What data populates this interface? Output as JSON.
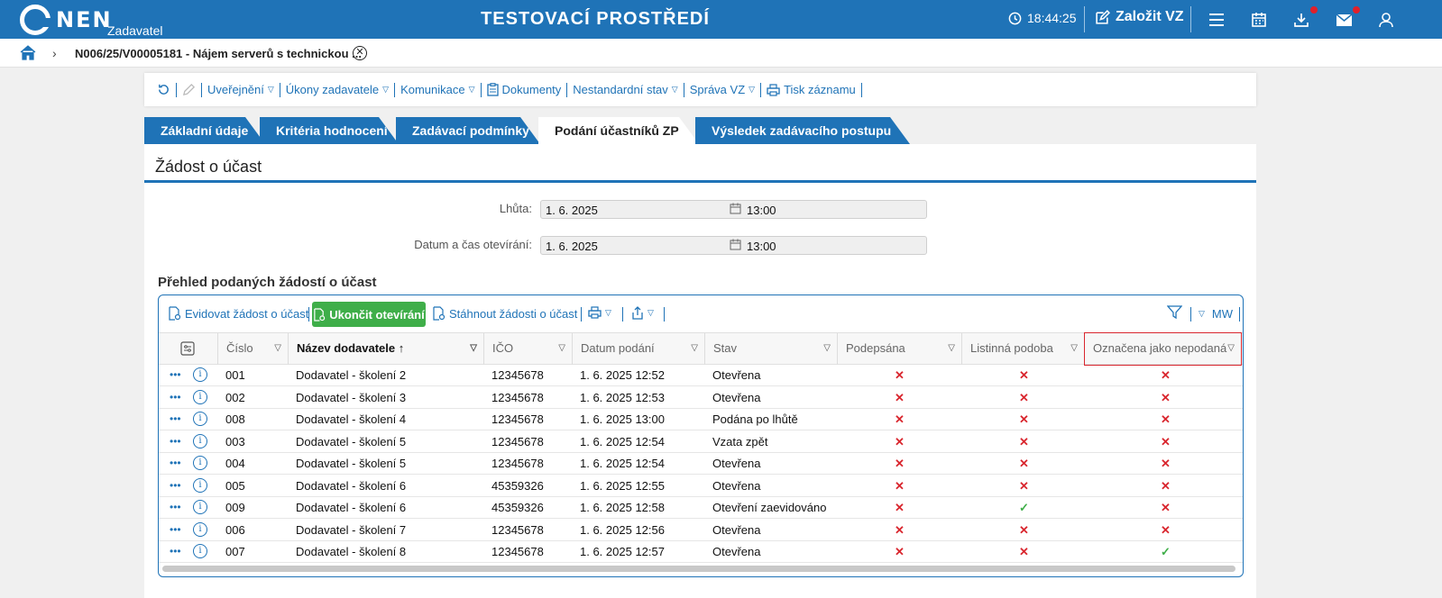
{
  "header": {
    "logo_text": "NEN",
    "logo_sub": "Zadavatel",
    "env_title": "TESTOVACÍ PROSTŘEDÍ",
    "time": "18:44:25",
    "create_label": "Založit VZ"
  },
  "breadcrumb": {
    "title": "N006/25/V00005181 - Nájem serverů s technickou ..."
  },
  "actions": {
    "items": [
      "Uveřejnění",
      "Úkony zadavatele",
      "Komunikace",
      "Dokumenty",
      "Nestandardní stav",
      "Správa VZ",
      "Tisk záznamu"
    ]
  },
  "tabs": [
    "Základní údaje",
    "Kritéria hodnocení",
    "Zadávací podmínky",
    "Podání účastníků ZP",
    "Výsledek zadávacího postupu"
  ],
  "panel": {
    "title": "Žádost o účast",
    "deadline_label": "Lhůta:",
    "deadline_date": "1. 6. 2025",
    "deadline_time": "13:00",
    "opening_label": "Datum a čas otevírání:",
    "opening_date": "1. 6. 2025",
    "opening_time": "13:00",
    "section_title": "Přehled podaných žádostí o účast"
  },
  "grid_toolbar": {
    "register": "Evidovat žádost o účast",
    "finish_opening": "Ukončit otevírání",
    "download": "Stáhnout žádosti o účast",
    "mw": "MW"
  },
  "columns": [
    "Číslo",
    "Název dodavatele",
    "IČO",
    "Datum podání",
    "Stav",
    "Podepsána",
    "Listinná podoba",
    "Označena jako nepodaná"
  ],
  "rows": [
    {
      "cislo": "001",
      "nazev": "Dodavatel - školení 2",
      "ico": "12345678",
      "datum": "1. 6. 2025 12:52",
      "stav": "Otevřena",
      "podepsana": "✕",
      "listinna": "✕",
      "nepodana": "✕"
    },
    {
      "cislo": "002",
      "nazev": "Dodavatel - školení 3",
      "ico": "12345678",
      "datum": "1. 6. 2025 12:53",
      "stav": "Otevřena",
      "podepsana": "✕",
      "listinna": "✕",
      "nepodana": "✕"
    },
    {
      "cislo": "008",
      "nazev": "Dodavatel - školení 4",
      "ico": "12345678",
      "datum": "1. 6. 2025 13:00",
      "stav": "Podána po lhůtě",
      "podepsana": "✕",
      "listinna": "✕",
      "nepodana": "✕"
    },
    {
      "cislo": "003",
      "nazev": "Dodavatel - školení 5",
      "ico": "12345678",
      "datum": "1. 6. 2025 12:54",
      "stav": "Vzata zpět",
      "podepsana": "✕",
      "listinna": "✕",
      "nepodana": "✕"
    },
    {
      "cislo": "004",
      "nazev": "Dodavatel - školení 5",
      "ico": "12345678",
      "datum": "1. 6. 2025 12:54",
      "stav": "Otevřena",
      "podepsana": "✕",
      "listinna": "✕",
      "nepodana": "✕"
    },
    {
      "cislo": "005",
      "nazev": "Dodavatel - školení 6",
      "ico": "45359326",
      "datum": "1. 6. 2025 12:55",
      "stav": "Otevřena",
      "podepsana": "✕",
      "listinna": "✕",
      "nepodana": "✕"
    },
    {
      "cislo": "009",
      "nazev": "Dodavatel - školení 6",
      "ico": "45359326",
      "datum": "1. 6. 2025 12:58",
      "stav": "Otevření zaevidováno",
      "podepsana": "✕",
      "listinna": "✓",
      "nepodana": "✕"
    },
    {
      "cislo": "006",
      "nazev": "Dodavatel - školení 7",
      "ico": "12345678",
      "datum": "1. 6. 2025 12:56",
      "stav": "Otevřena",
      "podepsana": "✕",
      "listinna": "✕",
      "nepodana": "✕"
    },
    {
      "cislo": "007",
      "nazev": "Dodavatel - školení 8",
      "ico": "12345678",
      "datum": "1. 6. 2025 12:57",
      "stav": "Otevřena",
      "podepsana": "✕",
      "listinna": "✕",
      "nepodana": "✓"
    }
  ],
  "colors": {
    "brand": "#1f73b7",
    "success": "#3fae49",
    "danger": "#d9262e"
  }
}
